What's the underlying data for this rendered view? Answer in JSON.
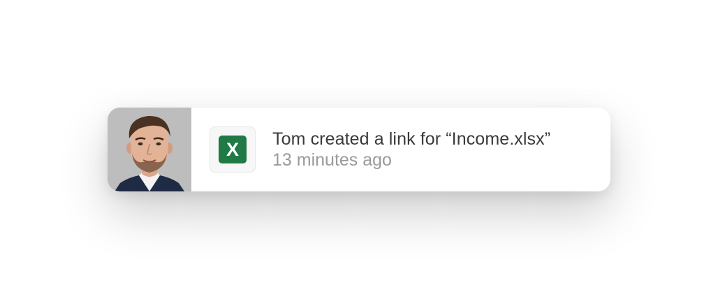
{
  "notification": {
    "message": "Tom created a link for “Income.xlsx”",
    "time": "13 minutes ago",
    "file_icon": {
      "name": "excel-icon",
      "glyph": "X",
      "color": "#1f7a45"
    },
    "avatar": {
      "name": "user-photo"
    }
  }
}
